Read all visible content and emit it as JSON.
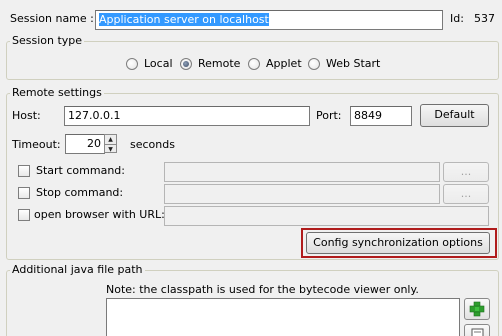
{
  "session": {
    "name_label": "Session name :",
    "name_value": "Application server on localhost",
    "id_label": "Id:",
    "id_value": "537"
  },
  "session_type": {
    "legend": "Session type",
    "options": [
      "Local",
      "Remote",
      "Applet",
      "Web Start"
    ],
    "selected": "Remote"
  },
  "remote": {
    "legend": "Remote settings",
    "host_label": "Host:",
    "host_value": "127.0.0.1",
    "port_label": "Port:",
    "port_value": "8849",
    "default_button": "Default",
    "timeout_label": "Timeout:",
    "timeout_value": "20",
    "timeout_unit": "seconds",
    "start_command_label": "Start command:",
    "stop_command_label": "Stop command:",
    "browse_button": "...",
    "open_browser_label": "open browser with URL:",
    "config_sync_button": "Config synchronization options"
  },
  "java_path": {
    "legend": "Additional java file path",
    "note": "Note: the classpath is used for the bytecode viewer only."
  }
}
